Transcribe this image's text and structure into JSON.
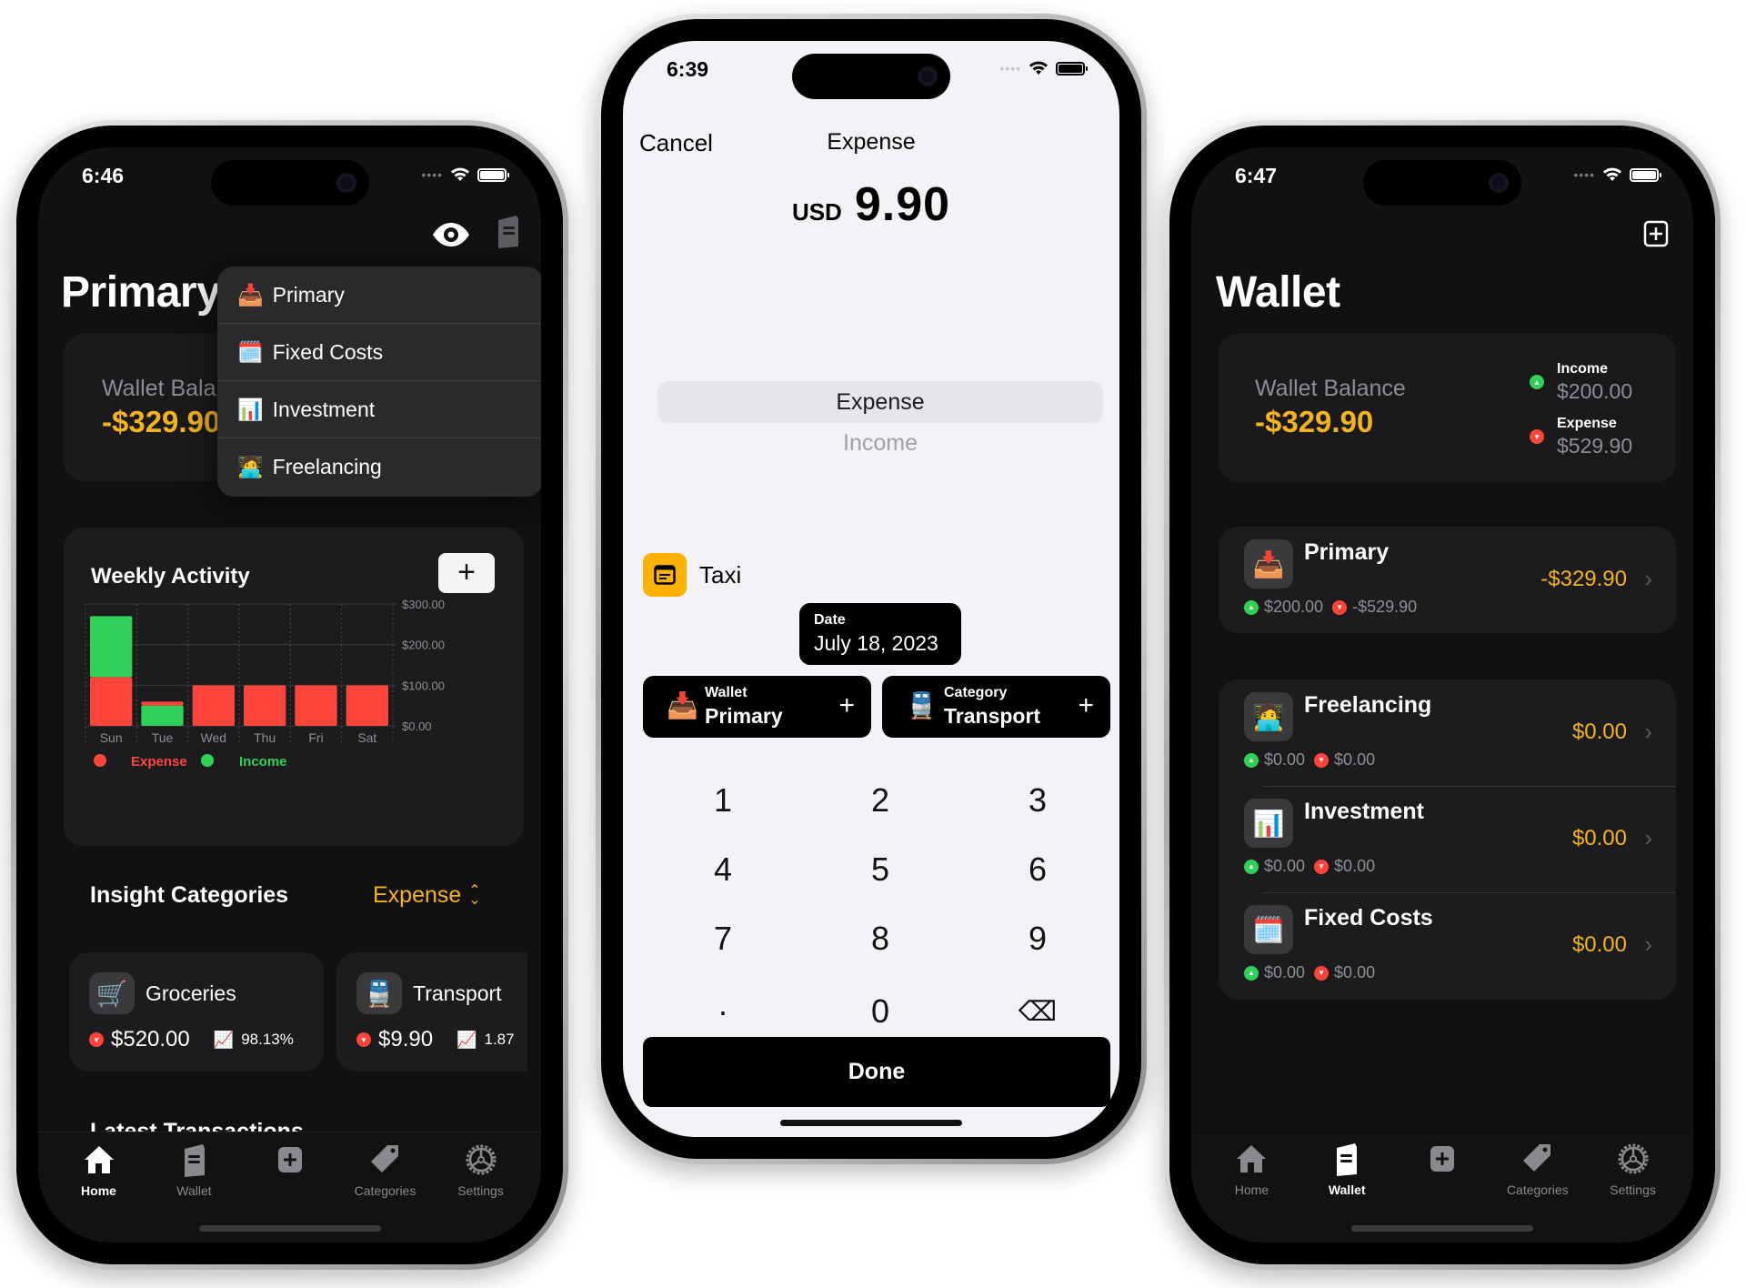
{
  "colors": {
    "accent_gold": "#f5b31c",
    "expense_red": "#ff453a",
    "income_green": "#30d158",
    "dark_bg": "#111112",
    "card_bg": "#1c1c1e",
    "light_bg": "#f2f2f7"
  },
  "home_screen": {
    "status_time": "6:46",
    "header_icons": [
      "eye-icon",
      "wallet-icon"
    ],
    "title": "Primary",
    "balance_card": {
      "label": "Wallet Balance",
      "value": "-$329.90"
    },
    "wallet_menu": {
      "items": [
        {
          "emoji": "📥",
          "label": "Primary"
        },
        {
          "emoji": "🗓️",
          "label": "Fixed Costs"
        },
        {
          "emoji": "📊",
          "label": "Investment"
        },
        {
          "emoji": "🧑‍💻",
          "label": "Freelancing"
        }
      ]
    },
    "weekly_activity": {
      "title": "Weekly Activity",
      "add_label": "+"
    },
    "insight": {
      "title": "Insight Categories",
      "filter": "Expense",
      "cards": [
        {
          "emoji": "🛒",
          "name": "Groceries",
          "amount": "$520.00",
          "percent": "98.13%"
        },
        {
          "emoji": "🚆",
          "name": "Transport",
          "amount": "$9.90",
          "percent": "1.87"
        }
      ]
    },
    "latest_title": "Latest Transactions",
    "tabs": [
      {
        "label": "Home",
        "icon": "house-icon",
        "active": true
      },
      {
        "label": "Wallet",
        "icon": "wallet-icon",
        "active": false
      },
      {
        "label": "",
        "icon": "plus-square-icon",
        "active": false
      },
      {
        "label": "Categories",
        "icon": "tag-icon",
        "active": false
      },
      {
        "label": "Settings",
        "icon": "gear-icon",
        "active": false
      }
    ]
  },
  "chart_data": {
    "type": "bar",
    "title": "Weekly Activity",
    "stacked": true,
    "categories": [
      "Sun",
      "Tue",
      "Wed",
      "Thu",
      "Fri",
      "Sat"
    ],
    "series": [
      {
        "name": "Expense",
        "color": "#ff453a",
        "values": [
          120,
          9.9,
          100,
          100,
          100,
          100
        ]
      },
      {
        "name": "Income",
        "color": "#30d158",
        "values": [
          150,
          50,
          0,
          0,
          0,
          0
        ]
      }
    ],
    "stack_order_note": "Sun: expense bottom, income top; Tue: income bottom, expense top",
    "y_ticks": [
      "$0.00",
      "$100.00",
      "$200.00",
      "$300.00"
    ],
    "ylim": [
      0,
      300
    ],
    "y_axis_side": "right",
    "grid": true,
    "legend": {
      "placement": "bottom-left",
      "entries": [
        "Expense",
        "Income"
      ]
    },
    "xlabel": "",
    "ylabel": ""
  },
  "add_screen": {
    "status_time": "6:39",
    "cancel_label": "Cancel",
    "nav_title": "Expense",
    "currency": "USD",
    "amount": "9.90",
    "segments": [
      {
        "label": "Expense",
        "selected": true
      },
      {
        "label": "Income",
        "selected": false
      }
    ],
    "note": {
      "label": "Taxi"
    },
    "date": {
      "label": "Date",
      "value": "July 18, 2023"
    },
    "wallet": {
      "label": "Wallet",
      "value": "Primary",
      "emoji": "📥"
    },
    "category": {
      "label": "Category",
      "value": "Transport",
      "emoji": "🚆"
    },
    "keypad": [
      "1",
      "2",
      "3",
      "4",
      "5",
      "6",
      "7",
      "8",
      "9",
      "·",
      "0",
      "⌫"
    ],
    "done_label": "Done"
  },
  "wallet_screen": {
    "status_time": "6:47",
    "title": "Wallet",
    "balance_card": {
      "label": "Wallet Balance",
      "value": "-$329.90",
      "income_label": "Income",
      "income_value": "$200.00",
      "expense_label": "Expense",
      "expense_value": "$529.90"
    },
    "wallets": [
      {
        "emoji": "📥",
        "name": "Primary",
        "balance": "-$329.90",
        "income": "$200.00",
        "expense": "-$529.90"
      },
      {
        "emoji": "🧑‍💻",
        "name": "Freelancing",
        "balance": "$0.00",
        "income": "$0.00",
        "expense": "$0.00"
      },
      {
        "emoji": "📊",
        "name": "Investment",
        "balance": "$0.00",
        "income": "$0.00",
        "expense": "$0.00"
      },
      {
        "emoji": "🗓️",
        "name": "Fixed Costs",
        "balance": "$0.00",
        "income": "$0.00",
        "expense": "$0.00"
      }
    ],
    "tabs": [
      {
        "label": "Home",
        "icon": "house-icon",
        "active": false
      },
      {
        "label": "Wallet",
        "icon": "wallet-icon",
        "active": true
      },
      {
        "label": "",
        "icon": "plus-square-icon",
        "active": false
      },
      {
        "label": "Categories",
        "icon": "tag-icon",
        "active": false
      },
      {
        "label": "Settings",
        "icon": "gear-icon",
        "active": false
      }
    ]
  }
}
